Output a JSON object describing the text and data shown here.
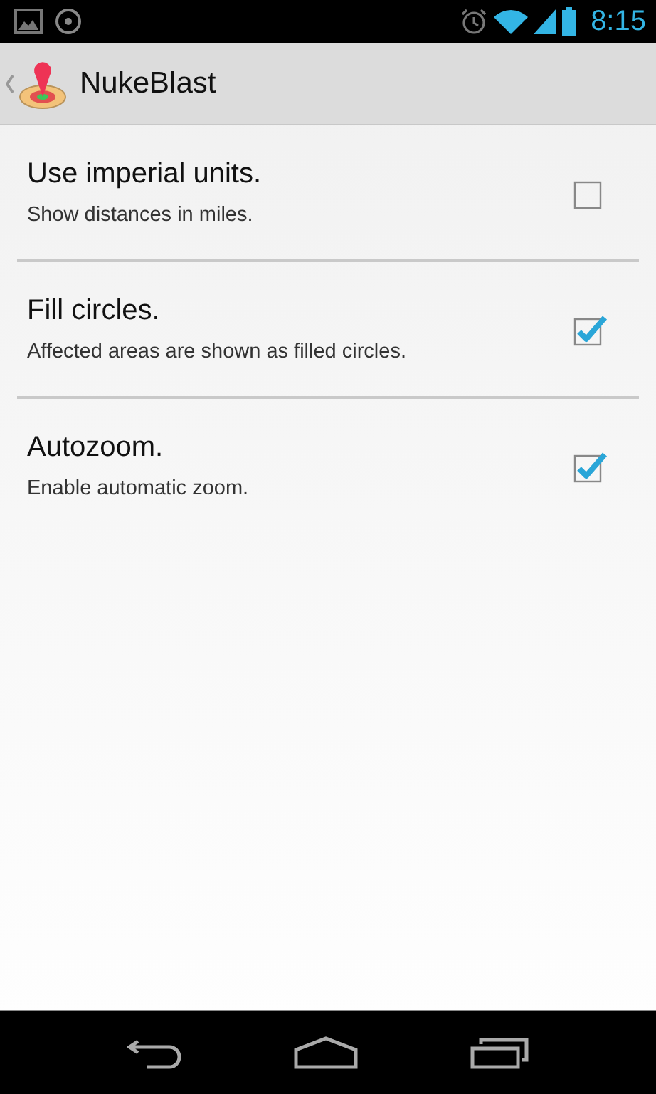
{
  "status_bar": {
    "time": "8:15"
  },
  "action_bar": {
    "title": "NukeBlast"
  },
  "preferences": [
    {
      "title": "Use imperial units.",
      "summary": "Show distances in miles.",
      "checked": false
    },
    {
      "title": "Fill circles.",
      "summary": "Affected areas are shown as filled circles.",
      "checked": true
    },
    {
      "title": "Autozoom.",
      "summary": "Enable automatic zoom.",
      "checked": true
    }
  ]
}
